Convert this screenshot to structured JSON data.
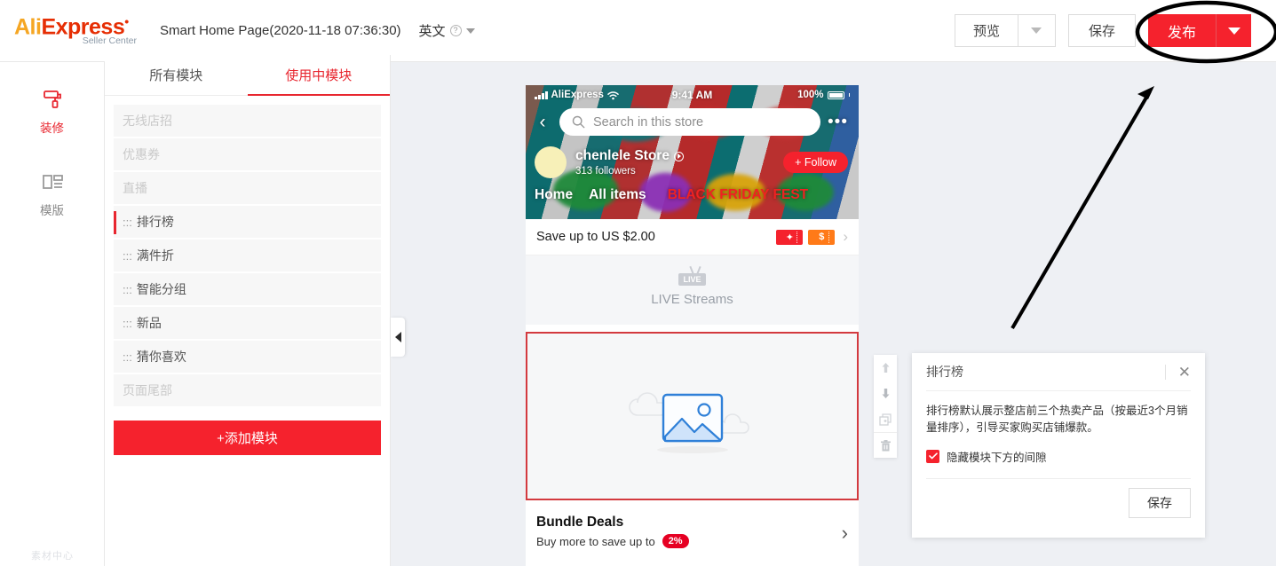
{
  "topbar": {
    "logo_ali": "Ali",
    "logo_express": "Express",
    "logo_sub": "Seller Center",
    "page_title": "Smart Home Page(2020-11-18 07:36:30)",
    "language": "英文",
    "help_icon": "question-mark-icon",
    "preview_label": "预览",
    "save_label": "保存",
    "publish_label": "发布",
    "publish_color": "#f5222d"
  },
  "rail": {
    "items": [
      {
        "label": "装修",
        "icon": "paint-roller-icon",
        "active": true
      },
      {
        "label": "模版",
        "icon": "template-grid-icon",
        "active": false
      }
    ],
    "bottom_ghost": "素材中心"
  },
  "module_panel": {
    "tabs": [
      {
        "label": "所有模块",
        "active": false
      },
      {
        "label": "使用中模块",
        "active": true
      }
    ],
    "grip": ":::",
    "items": [
      {
        "label": "无线店招",
        "locked": true,
        "selected": false
      },
      {
        "label": "优惠券",
        "locked": true,
        "selected": false
      },
      {
        "label": "直播",
        "locked": true,
        "selected": false
      },
      {
        "label": "排行榜",
        "locked": false,
        "selected": true
      },
      {
        "label": "满件折",
        "locked": false,
        "selected": false
      },
      {
        "label": "智能分组",
        "locked": false,
        "selected": false
      },
      {
        "label": "新品",
        "locked": false,
        "selected": false
      },
      {
        "label": "猜你喜欢",
        "locked": false,
        "selected": false
      },
      {
        "label": "页面尾部",
        "locked": true,
        "selected": false
      }
    ],
    "add_module_label": "+添加模块",
    "collapse_icon": "chevron-left-icon"
  },
  "phone": {
    "status": {
      "carrier": "AliExpress",
      "time": "9:41 AM",
      "battery": "100%",
      "signal_icon": "signal-bars-icon",
      "wifi_icon": "wifi-icon",
      "battery_icon": "battery-full-icon"
    },
    "back_icon": "chevron-left-icon",
    "search_placeholder": "Search in this store",
    "search_icon": "search-icon",
    "more_icon": "ellipsis-icon",
    "store_name": "chenlele Store",
    "store_play_icon": "play-circle-icon",
    "followers": "313  followers",
    "follow_label": "+ Follow",
    "nav": [
      {
        "label": "Home",
        "promo": false
      },
      {
        "label": "All items",
        "promo": false
      },
      {
        "label": "BLACK FRIDAY FEST",
        "promo": true
      }
    ],
    "coupon_text": "Save up to US $2.00",
    "coupon_tickets": [
      {
        "glyph": "✦",
        "color": "#f5222d"
      },
      {
        "glyph": "$",
        "color": "#ff7a18"
      }
    ],
    "coupon_chevron": "chevron-right-icon",
    "live_badge": "LIVE",
    "live_label": "LIVE Streams",
    "selected_module_placeholder_icon": "image-placeholder-icon",
    "bundle_title": "Bundle Deals",
    "bundle_sub": "Buy more to save up to",
    "bundle_badge": "2%",
    "bundle_chevron": "chevron-right-icon"
  },
  "module_toolbar": {
    "buttons": [
      {
        "icon": "arrow-up-icon",
        "name": "move-up"
      },
      {
        "icon": "arrow-down-icon",
        "name": "move-down"
      },
      {
        "icon": "copy-icon",
        "name": "duplicate"
      },
      {
        "icon": "trash-icon",
        "name": "delete"
      }
    ]
  },
  "settings_panel": {
    "title": "排行榜",
    "close_icon": "close-icon",
    "description": "排行榜默认展示整店前三个热卖产品（按最近3个月销量排序），引导买家购买店铺爆款。",
    "checkbox_label": "隐藏模块下方的间隙",
    "checkbox_checked": true,
    "checkbox_color": "#f5222d",
    "save_label": "保存"
  },
  "annotations": {
    "ellipse": "highlight-ellipse",
    "arrow": "pointer-arrow"
  }
}
